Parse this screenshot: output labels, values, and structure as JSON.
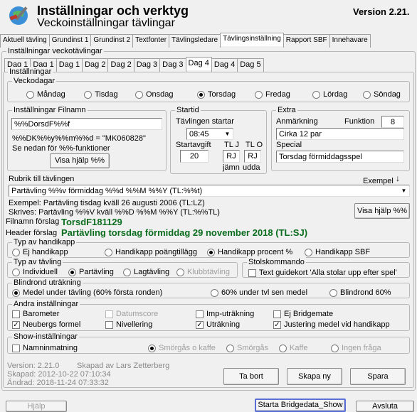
{
  "header": {
    "title": "Inställningar och verktyg",
    "subtitle": "Veckoinställningar tävlingar",
    "version": "Version  2.21."
  },
  "main_tabs": [
    "Aktuell tävling",
    "Grundinst 1",
    "Grundinst 2",
    "Textfonter",
    "Tävlingsledare",
    "Tävlingsinställning",
    "Rapport SBF",
    "Innehavare"
  ],
  "week_group_label": "Inställningar veckotävlingar",
  "day_tabs": [
    "Dag 1",
    "Dag 1",
    "Dag 1",
    "Dag 2",
    "Dag 2",
    "Dag 3",
    "Dag 3",
    "Dag 4",
    "Dag 4",
    "Dag 5"
  ],
  "settings_label": "Inställningar",
  "weekdays": {
    "label": "Veckodagar",
    "options": [
      "Måndag",
      "Tisdag",
      "Onsdag",
      "Torsdag",
      "Fredag",
      "Lördag",
      "Söndag"
    ],
    "selected": "Torsdag"
  },
  "filename": {
    "label": "Inställningar Filnamn",
    "value": "%%DorsdF%%f",
    "example": "%%DK%%y%%m%%d = \"MK060828\"",
    "hint": "Se nedan för %%-funktioner",
    "help_button": "Visa hjälp %%"
  },
  "start": {
    "label": "Startid",
    "starts_label": "Tävlingen startar",
    "time": "08:45",
    "fee_label": "Startavgift",
    "fee": "20",
    "tlj_label": "TL J",
    "tlo_label": "TL O",
    "tlj": "RJ",
    "tlo": "RJ",
    "even_label": "jämn",
    "odd_label": "udda"
  },
  "extra": {
    "label": "Extra",
    "note_label": "Anmärkning",
    "function_label": "Funktion",
    "function_value": "8",
    "note_value": "Cirka 12 par",
    "special_label": "Special",
    "special_value": "Torsdag förmiddagsspel"
  },
  "heading": {
    "label": "Rubrik till tävlingen",
    "example_label": "Exempel",
    "value": "Partävling %%v förmiddag %%d %%M %%Y (TL:%%t)",
    "example_text": "Exempel: Partävling tisdag kväll 26 augusti 2006 (TL:LZ)",
    "written_text": "Skrives: Partävling %%V kväll %%D %%M %%Y (TL:%%TL)",
    "help_button": "Visa hjälp %%",
    "filename_suggestion_label": "Filnamn förslag",
    "filename_suggestion": "TorsdF181129",
    "header_suggestion_label": "Header förslag",
    "header_suggestion": "Partävling torsdag förmiddag 29 november 2018 (TL:SJ)"
  },
  "handicap": {
    "label": "Typ av handikapp",
    "options": [
      "Ej handikapp",
      "Handikapp poängtillägg",
      "Handikapp procent %",
      "Handikapp SBF"
    ],
    "selected": "Handikapp procent %"
  },
  "competition_type": {
    "label": "Typ av tävling",
    "options": [
      "Individuell",
      "Partävling",
      "Lagtävling",
      "Klubbtävling"
    ],
    "selected": "Partävling"
  },
  "table_command": {
    "label": "Stolskommando",
    "checkbox": "Text guidekort 'Alla stolar upp efter spel'"
  },
  "blind": {
    "label": "Blindrond uträkning",
    "options": [
      "Medel under tävling (60% första ronden)",
      "60% under tvl sen medel",
      "Blindrond 60%"
    ],
    "selected": "Medel under tävling (60% första ronden)"
  },
  "other": {
    "label": "Andra inställningar",
    "items": [
      {
        "label": "Barometer",
        "checked": false,
        "enabled": true
      },
      {
        "label": "Datumscore",
        "checked": false,
        "enabled": false
      },
      {
        "label": "Imp-uträkning",
        "checked": false,
        "enabled": true
      },
      {
        "label": "Ej Bridgemate",
        "checked": false,
        "enabled": true
      },
      {
        "label": "Neubergs formel",
        "checked": true,
        "enabled": true
      },
      {
        "label": "Nivellering",
        "checked": false,
        "enabled": true
      },
      {
        "label": "Uträkning",
        "checked": true,
        "enabled": true
      },
      {
        "label": "Justering medel vid handikapp",
        "checked": true,
        "enabled": true
      }
    ]
  },
  "show": {
    "label": "Show-inställningar",
    "name_input": "Namninmatning",
    "options": [
      "Smörgås o kaffe",
      "Smörgås",
      "Kaffe",
      "Ingen fråga"
    ],
    "selected": "Smörgås o kaffe"
  },
  "meta": {
    "version": "Version: 2.21.0",
    "created_by": "Skapad av Lars Zetterberg",
    "created": "Skapad: 2012-10-22 07:10:34",
    "changed": "Ändrad:  2018-11-24 07:33:32"
  },
  "actions": {
    "delete": "Ta bort",
    "create_new": "Skapa ny",
    "save": "Spara"
  },
  "bottom": {
    "help": "Hjälp",
    "start_bridgedata": "Starta Bridgedata_Show",
    "quit": "Avsluta"
  }
}
